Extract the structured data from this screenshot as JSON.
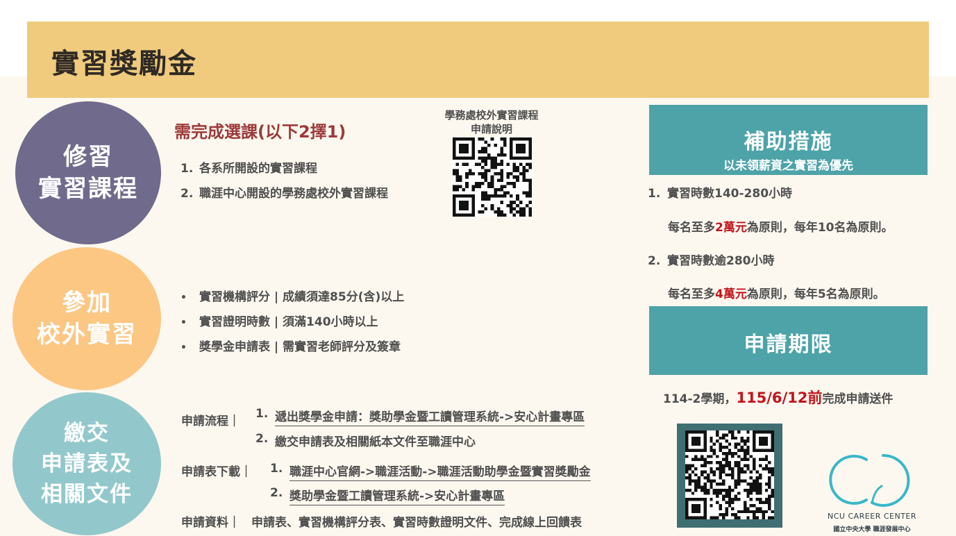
{
  "header": {
    "title": "實習獎勵金"
  },
  "section1": {
    "circle_line1": "修習",
    "circle_line2": "實習課程",
    "title": "需完成選課(以下2擇1)",
    "items": [
      {
        "num": "1.",
        "text": "各系所開設的實習課程"
      },
      {
        "num": "2.",
        "text": "職涯中心開設的學務處校外實習課程"
      }
    ],
    "qr_caption_line1": "學務處校外實習課程",
    "qr_caption_line2": "申請說明"
  },
  "section2": {
    "circle_line1": "參加",
    "circle_line2": "校外實習",
    "bullet": "•",
    "items": [
      "實習機構評分 | 成績須達85分(含)以上",
      "實習證明時數 | 須滿140小時以上",
      "獎學金申請表 | 需實習老師評分及簽章"
    ]
  },
  "section3": {
    "circle_line1": "繳交",
    "circle_line2": "申請表及",
    "circle_line3": "相關文件",
    "process_label": "申請流程｜",
    "process_items": [
      {
        "num": "1.",
        "text": "遞出獎學金申請：獎助學金暨工讀管理系統->安心計畫專區"
      },
      {
        "num": "2.",
        "text": "繳交申請表及相關紙本文件至職涯中心"
      }
    ],
    "download_label": "申請表下載｜",
    "download_items": [
      {
        "num": "1.",
        "text": "職涯中心官網->職涯活動->職涯活動助學金暨實習獎勵金"
      },
      {
        "num": "2.",
        "text": "獎助學金暨工讀管理系統->安心計畫專區"
      }
    ],
    "materials_label": "申請資料｜",
    "materials_text": "申請表、實習機構評分表、實習時數證明文件、完成線上回饋表"
  },
  "subsidy": {
    "title": "補助措施",
    "subtitle": "以未領薪資之實習為優先",
    "items": [
      {
        "num": "1.",
        "hours": "實習時數140-280小時",
        "pre": "每名至多",
        "amount": "2萬元",
        "post": "為原則，每年10名為原則。"
      },
      {
        "num": "2.",
        "hours": "實習時數逾280小時",
        "pre": "每名至多",
        "amount": "4萬元",
        "post": "為原則，每年5名為原則。"
      }
    ]
  },
  "deadline": {
    "title": "申請期限",
    "pre": "114-2學期，",
    "date": "115/6/12前",
    "post": "完成申請送件"
  },
  "logo": {
    "name": "NCU CAREER CENTER",
    "sub": "國立中央大學 職涯發展中心"
  },
  "colors": {
    "banner": "#f0cb7e",
    "purple": "#706b8c",
    "orange": "#fcc783",
    "teal_light": "#92c8cc",
    "teal": "#4da3a8",
    "red": "#c0141d"
  }
}
